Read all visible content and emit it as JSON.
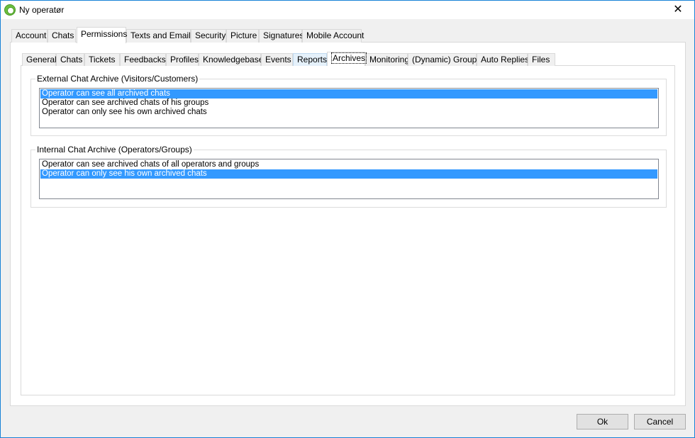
{
  "window": {
    "title": "Ny operatør"
  },
  "outer_tabs": [
    {
      "label": "Account"
    },
    {
      "label": "Chats"
    },
    {
      "label": "Permissions"
    },
    {
      "label": "Texts and Emails"
    },
    {
      "label": "Security"
    },
    {
      "label": "Picture"
    },
    {
      "label": "Signatures"
    },
    {
      "label": "Mobile Account"
    }
  ],
  "inner_tabs": [
    {
      "label": "General"
    },
    {
      "label": "Chats"
    },
    {
      "label": "Tickets"
    },
    {
      "label": "Feedbacks"
    },
    {
      "label": "Profiles"
    },
    {
      "label": "Knowledgebase"
    },
    {
      "label": "Events"
    },
    {
      "label": "Reports"
    },
    {
      "label": "Archives"
    },
    {
      "label": "Monitoring"
    },
    {
      "label": "(Dynamic) Groups"
    },
    {
      "label": "Auto Replies"
    },
    {
      "label": "Files"
    }
  ],
  "external_archive": {
    "legend": "External Chat Archive (Visitors/Customers)",
    "options": [
      {
        "label": "Operator can see all archived chats",
        "selected": true
      },
      {
        "label": "Operator can see archived chats of his groups",
        "selected": false
      },
      {
        "label": "Operator can only see his own archived chats",
        "selected": false
      }
    ]
  },
  "internal_archive": {
    "legend": "Internal Chat Archive (Operators/Groups)",
    "options": [
      {
        "label": "Operator can see archived chats of all operators and groups",
        "selected": false
      },
      {
        "label": "Operator can only see his own archived chats",
        "selected": true
      }
    ]
  },
  "buttons": {
    "ok": "Ok",
    "cancel": "Cancel"
  },
  "colors": {
    "selection": "#3399ff",
    "window_border": "#1883d7"
  },
  "icons": {
    "app": "gear-icon",
    "close": "close-icon"
  }
}
